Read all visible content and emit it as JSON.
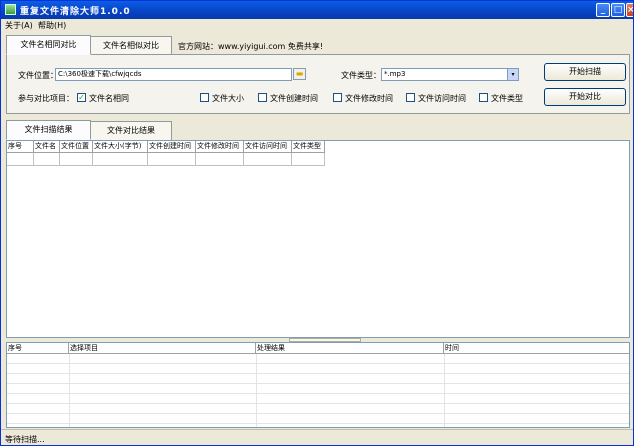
{
  "window": {
    "title": "重复文件清除大师1.0.0"
  },
  "titlebar_buttons": {
    "minimize": "_",
    "maximize": "□",
    "close": "×"
  },
  "menu": {
    "about": "关于(A)",
    "help": "帮助(H)"
  },
  "top_tabs": [
    {
      "label": "文件名相同对比"
    },
    {
      "label": "文件名相似对比"
    }
  ],
  "website": {
    "label": "官方网站：www.yiyigui.com 免费共享!"
  },
  "form": {
    "file_location_label": "文件位置：",
    "file_location_value": "C:\\360极速下载\\cfwjqcds",
    "file_type_label": "文件类型：",
    "file_type_value": "*.mp3",
    "criteria_label": "参与对比项目：",
    "criteria": [
      {
        "label": "文件名相同",
        "checked": true
      },
      {
        "label": "文件大小",
        "checked": false
      },
      {
        "label": "文件创建时间",
        "checked": false
      },
      {
        "label": "文件修改时间",
        "checked": false
      },
      {
        "label": "文件访问时间",
        "checked": false
      },
      {
        "label": "文件类型",
        "checked": false
      }
    ],
    "check_mark": "✓",
    "folder_icon": "folder-icon",
    "combo_arrow": "▾",
    "start_scan": "开始扫描",
    "start_compare": "开始对比"
  },
  "result_tabs": [
    {
      "label": "文件扫描结果"
    },
    {
      "label": "文件对比结果"
    }
  ],
  "scan_table": {
    "columns": [
      "序号",
      "文件名",
      "文件位置",
      "文件大小(字节)",
      "文件创建时间",
      "文件修改时间",
      "文件访问时间",
      "文件类型"
    ]
  },
  "log_table": {
    "columns": [
      "序号",
      "选择项目",
      "处理结果",
      "时间"
    ]
  },
  "status": {
    "text": "等待扫描..."
  }
}
